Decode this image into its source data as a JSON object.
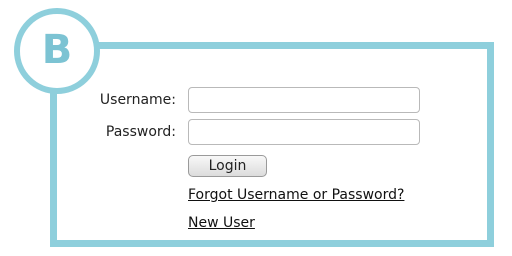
{
  "badge": {
    "letter": "B"
  },
  "colors": {
    "accent": "#8ecfdc",
    "badge_text": "#7cc3d3"
  },
  "form": {
    "username_label": "Username:",
    "username_value": "",
    "password_label": "Password:",
    "password_value": "",
    "login_label": "Login",
    "forgot_link": "Forgot Username or Password?",
    "new_user_link": "New User"
  }
}
